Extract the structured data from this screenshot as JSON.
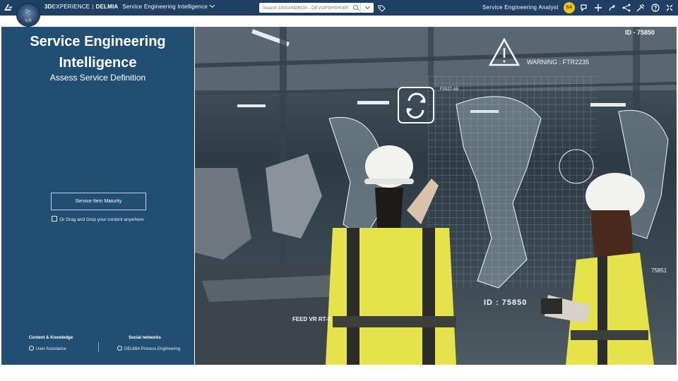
{
  "header": {
    "brand_3d": "3D",
    "brand_experience": "EXPERIENCE",
    "brand_separator": "|",
    "brand_product": "DELMIA",
    "app_name": "Service Engineering Intelligence",
    "compass_version": "V,R",
    "search_placeholder": "Search DSSANDBOX - DEVOPSHSHI3PI",
    "role": "Service Engineering Analyst",
    "avatar_initials": "SA",
    "icons": [
      "3ds-logo-icon",
      "compass-icon",
      "chevron-down-icon",
      "search-icon",
      "tag-icon",
      "notifications-icon",
      "add-icon",
      "share-icon",
      "share-network-icon",
      "tools-icon",
      "help-icon",
      "collapse-icon"
    ],
    "colors": {
      "bar": "#1f3f63",
      "avatar": "#f5c11a"
    }
  },
  "left_panel": {
    "title": "Service Engineering Intelligence",
    "subtitle": "Assess Service Definition",
    "button_label": "Service Item Maturity",
    "dragdrop_text": "Or Drag and Drop your content anywhere",
    "footer": {
      "col1_heading": "Content & Knowledge",
      "col1_link": "User Assistance",
      "col2_heading": "Social networks",
      "col2_link": "DELMIA Process Engineering"
    },
    "colors": {
      "background": "#214f74"
    }
  },
  "hero": {
    "labels": {
      "id_top": "ID - 75850",
      "warning": "WARNING : FTR2235",
      "part": "F2527-A5",
      "feed": "FEED VR RT-5",
      "id_bottom": "ID : 75850",
      "code_right": "75851"
    }
  }
}
